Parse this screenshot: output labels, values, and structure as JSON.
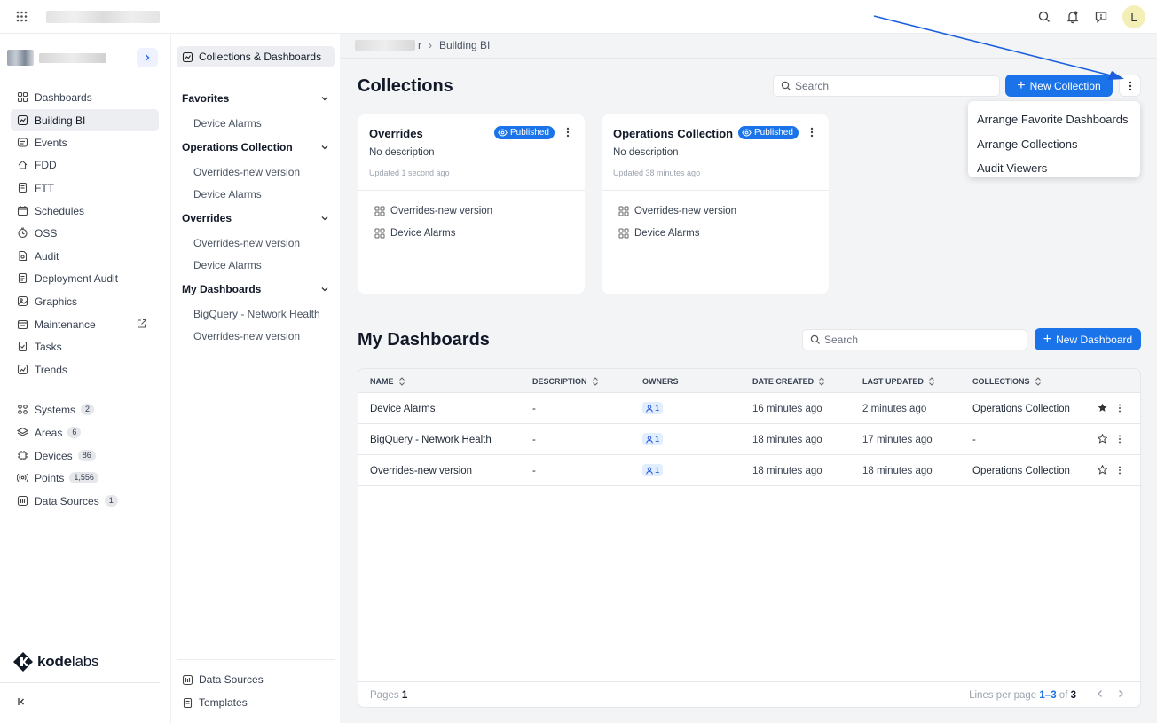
{
  "topbar": {
    "avatar_letter": "L"
  },
  "leftnav": {
    "items": [
      {
        "label": "Dashboards",
        "icon": "dashboards-icon"
      },
      {
        "label": "Building BI",
        "icon": "building-bi-icon"
      },
      {
        "label": "Events",
        "icon": "events-icon"
      },
      {
        "label": "FDD",
        "icon": "fdd-icon"
      },
      {
        "label": "FTT",
        "icon": "ftt-icon"
      },
      {
        "label": "Schedules",
        "icon": "schedules-icon"
      },
      {
        "label": "OSS",
        "icon": "oss-icon"
      },
      {
        "label": "Audit",
        "icon": "audit-icon"
      },
      {
        "label": "Deployment Audit",
        "icon": "deployment-audit-icon"
      },
      {
        "label": "Graphics",
        "icon": "graphics-icon"
      },
      {
        "label": "Maintenance",
        "icon": "maintenance-icon"
      },
      {
        "label": "Tasks",
        "icon": "tasks-icon"
      },
      {
        "label": "Trends",
        "icon": "trends-icon"
      }
    ],
    "counts": [
      {
        "label": "Systems",
        "count": "2"
      },
      {
        "label": "Areas",
        "count": "6"
      },
      {
        "label": "Devices",
        "count": "86"
      },
      {
        "label": "Points",
        "count": "1,556"
      },
      {
        "label": "Data Sources",
        "count": "1"
      }
    ],
    "brand_bold": "kode",
    "brand_light": "labs"
  },
  "panel2": {
    "header": "Collections & Dashboards",
    "sections": [
      {
        "title": "Favorites",
        "items": [
          "Device Alarms"
        ]
      },
      {
        "title": "Operations Collection",
        "items": [
          "Overrides-new version",
          "Device Alarms"
        ]
      },
      {
        "title": "Overrides",
        "items": [
          "Overrides-new version",
          "Device Alarms"
        ]
      },
      {
        "title": "My Dashboards",
        "items": [
          "BigQuery - Network Health",
          "Overrides-new version"
        ]
      }
    ],
    "bottom": [
      "Data Sources",
      "Templates"
    ]
  },
  "breadcrumb": {
    "tail": "r",
    "current": "Building BI"
  },
  "collections": {
    "title": "Collections",
    "search_placeholder": "Search",
    "new_button": "New Collection",
    "cards": [
      {
        "title": "Overrides",
        "status": "Published",
        "description": "No description",
        "updated": "Updated 1 second ago",
        "items": [
          "Overrides-new version",
          "Device Alarms"
        ]
      },
      {
        "title": "Operations Collection",
        "status": "Published",
        "description": "No description",
        "updated": "Updated 38 minutes ago",
        "items": [
          "Overrides-new version",
          "Device Alarms"
        ]
      }
    ]
  },
  "menu": {
    "items": [
      "Arrange Favorite Dashboards",
      "Arrange Collections",
      "Audit Viewers"
    ]
  },
  "dashboards": {
    "title": "My Dashboards",
    "search_placeholder": "Search",
    "new_button": "New Dashboard",
    "columns": [
      "NAME",
      "DESCRIPTION",
      "OWNERS",
      "DATE CREATED",
      "LAST UPDATED",
      "COLLECTIONS"
    ],
    "rows": [
      {
        "name": "Device Alarms",
        "description": "-",
        "owners": "1",
        "created": "16 minutes ago",
        "updated": "2 minutes ago",
        "collections": "Operations Collection",
        "favorite": true
      },
      {
        "name": "BigQuery - Network Health",
        "description": "-",
        "owners": "1",
        "created": "18 minutes ago",
        "updated": "17 minutes ago",
        "collections": "-",
        "favorite": false
      },
      {
        "name": "Overrides-new version",
        "description": "-",
        "owners": "1",
        "created": "18 minutes ago",
        "updated": "18 minutes ago",
        "collections": "Operations Collection",
        "favorite": false
      }
    ],
    "footer": {
      "pages_label": "Pages",
      "pages_value": "1",
      "lines_label": "Lines per page",
      "range": "1–3",
      "of": "of",
      "total": "3"
    }
  },
  "colors": {
    "primary": "#1a73e8",
    "annotation_arrow": "#1a5fe0"
  }
}
